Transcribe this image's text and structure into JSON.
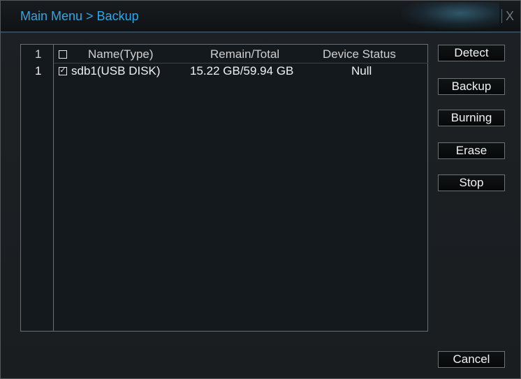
{
  "window": {
    "title": "Main Menu > Backup",
    "close_label": "X"
  },
  "table": {
    "header": {
      "index": "1",
      "name": "Name(Type)",
      "remain_total": "Remain/Total",
      "device_status": "Device Status",
      "select_all_checked": false
    },
    "rows": [
      {
        "index": "1",
        "checked": true,
        "name": "sdb1(USB DISK)",
        "remain_total": "15.22 GB/59.94 GB",
        "device_status": "Null"
      }
    ]
  },
  "buttons": {
    "detect": "Detect",
    "backup": "Backup",
    "burning": "Burning",
    "erase": "Erase",
    "stop": "Stop",
    "cancel": "Cancel"
  },
  "colors": {
    "title": "#2fa6ea",
    "background": "#1b1f22",
    "table_background": "#14191d"
  },
  "icons": {
    "close": "close-icon",
    "checkbox_unchecked": "checkbox-icon",
    "checkbox_checked": "checkbox-checked-icon"
  }
}
